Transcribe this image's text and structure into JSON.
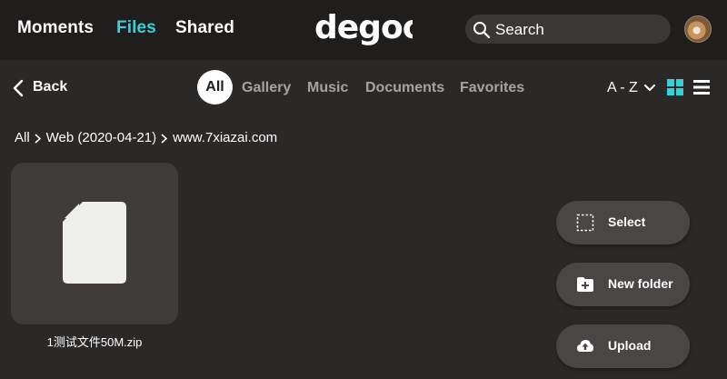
{
  "header": {
    "nav": [
      {
        "label": "Moments"
      },
      {
        "label": "Files"
      },
      {
        "label": "Shared"
      }
    ],
    "logo_text": "degoo",
    "search": {
      "placeholder": "Search",
      "icon": "search-icon"
    },
    "avatar_icon": "avatar"
  },
  "toolbar": {
    "back_label": "Back",
    "tabs": [
      {
        "label": "All"
      },
      {
        "label": "Gallery"
      },
      {
        "label": "Music"
      },
      {
        "label": "Documents"
      },
      {
        "label": "Favorites"
      }
    ],
    "active_tab": "All",
    "sort_label": "A - Z",
    "view_modes": [
      "grid",
      "list"
    ],
    "active_view": "grid"
  },
  "breadcrumb": [
    "All",
    "Web (2020-04-21)",
    "www.7xiazai.com"
  ],
  "files": [
    {
      "name": "1测试文件50M.zip",
      "icon": "file-icon"
    }
  ],
  "actions": [
    {
      "label": "Select",
      "icon": "select-icon"
    },
    {
      "label": "New folder",
      "icon": "new-folder-icon"
    },
    {
      "label": "Upload",
      "icon": "upload-icon"
    }
  ],
  "colors": {
    "accent": "#37d0d8",
    "background": "#2b2928",
    "topbar": "#201e1d",
    "tile": "#3f3b3a",
    "button": "#4a4645"
  }
}
